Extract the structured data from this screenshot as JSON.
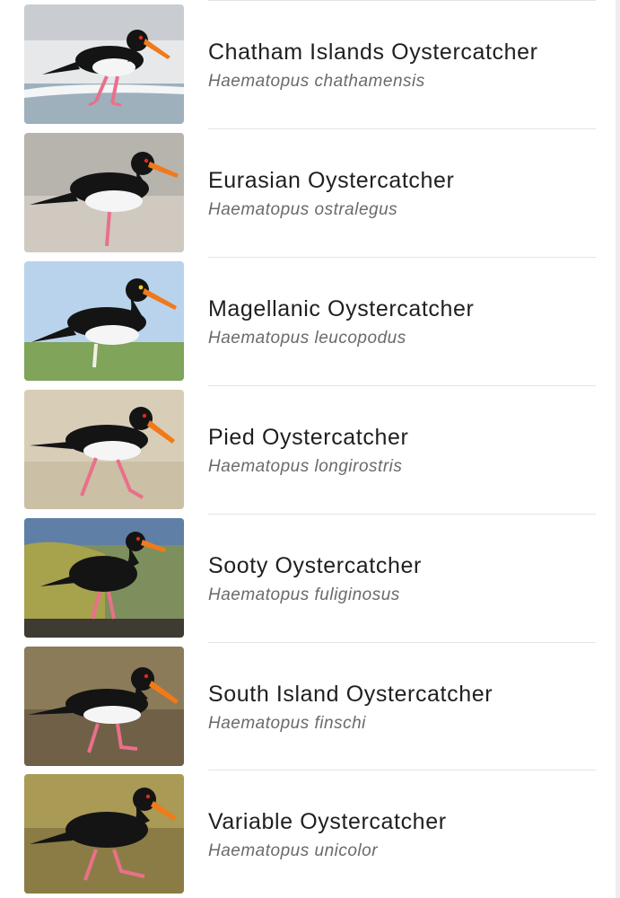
{
  "species_list": [
    {
      "common_name": "Chatham Islands Oystercatcher",
      "scientific_name": "Haematopus chathamensis",
      "photo": "chatham-islands-oystercatcher-photo"
    },
    {
      "common_name": "Eurasian Oystercatcher",
      "scientific_name": "Haematopus ostralegus",
      "photo": "eurasian-oystercatcher-photo"
    },
    {
      "common_name": "Magellanic Oystercatcher",
      "scientific_name": "Haematopus leucopodus",
      "photo": "magellanic-oystercatcher-photo"
    },
    {
      "common_name": "Pied Oystercatcher",
      "scientific_name": "Haematopus longirostris",
      "photo": "pied-oystercatcher-photo"
    },
    {
      "common_name": "Sooty Oystercatcher",
      "scientific_name": "Haematopus fuliginosus",
      "photo": "sooty-oystercatcher-photo"
    },
    {
      "common_name": "South Island Oystercatcher",
      "scientific_name": "Haematopus finschi",
      "photo": "south-island-oystercatcher-photo"
    },
    {
      "common_name": "Variable Oystercatcher",
      "scientific_name": "Haematopus unicolor",
      "photo": "variable-oystercatcher-photo"
    }
  ],
  "colors": {
    "title_text": "#1f1f1f",
    "subtitle_text": "#6a6a6a",
    "divider": "#e3e3e3",
    "bird_black": "#141414",
    "bill_orange": "#f07a1a",
    "legs_pink": "#e9708a"
  }
}
